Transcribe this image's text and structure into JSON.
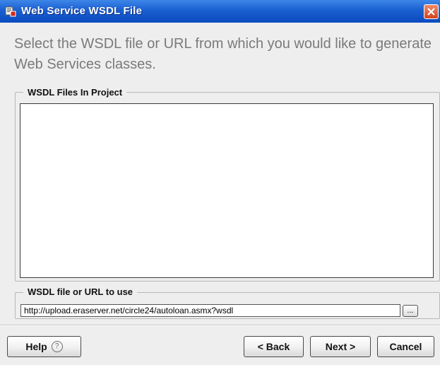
{
  "window": {
    "title": "Web Service WSDL File",
    "icon": "wsdl-app-icon",
    "close_icon": "close-icon"
  },
  "heading": "Select the WSDL file or URL from which you would like to generate Web Services classes.",
  "wsdl_files_group": {
    "label": "WSDL Files In Project",
    "items": []
  },
  "url_group": {
    "label": "WSDL file or URL to use",
    "url_value": "http://upload.eraserver.net/circle24/autoloan.asmx?wsdl",
    "browse_label": "..."
  },
  "buttons": {
    "help": "Help",
    "help_icon": "question-circle-icon",
    "back": "< Back",
    "next": "Next >",
    "cancel": "Cancel"
  },
  "colors": {
    "titlebar": "#0a4bc0",
    "client_bg": "#eeeeee",
    "heading_text": "#7a7a7a",
    "close_button": "#d4421c"
  }
}
